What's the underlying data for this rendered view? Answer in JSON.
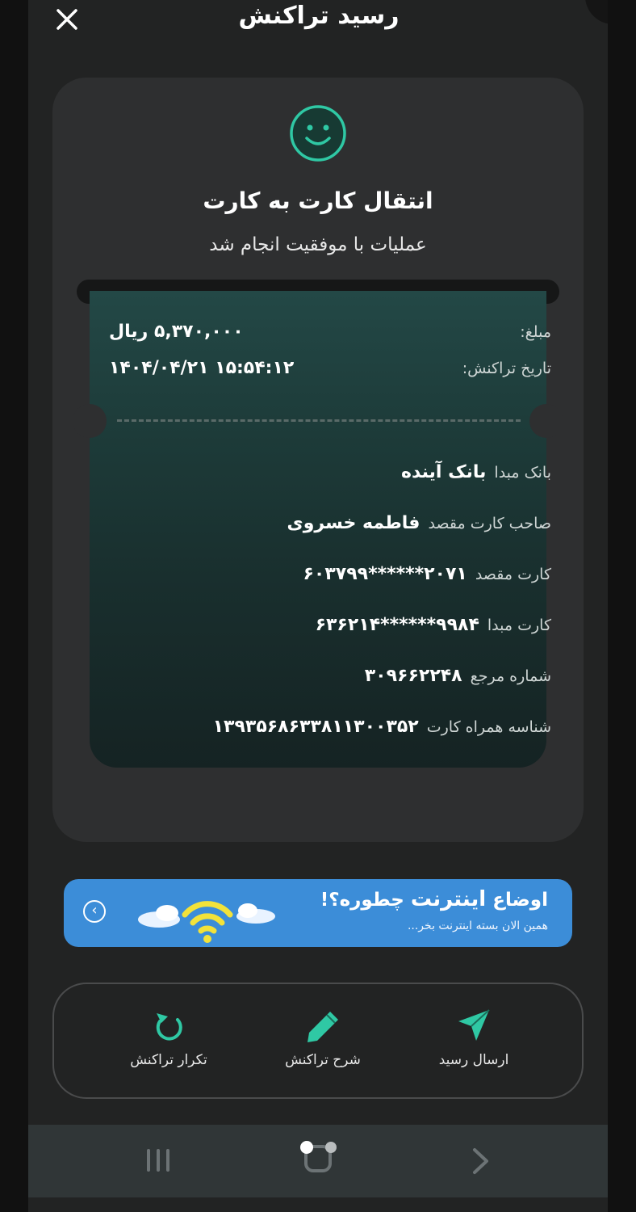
{
  "header": {
    "title": "رسید تراکنش",
    "close_icon": "close-icon"
  },
  "receipt": {
    "status_icon": "smile-icon",
    "heading": "انتقال کارت به کارت",
    "subtitle": "عملیات با موفقیت انجام شد",
    "amount": {
      "label": "مبلغ:",
      "value": "۵,۳۷۰,۰۰۰ ریال"
    },
    "date": {
      "label": "تاریخ تراکنش:",
      "value": "۱۴۰۴/۰۴/۲۱ ۱۵:۵۴:۱۲"
    },
    "details": [
      {
        "label": "بانک مبدا",
        "value": "بانک آینده"
      },
      {
        "label": "صاحب کارت مقصد",
        "value": "فاطمه خسروی"
      },
      {
        "label": "کارت مقصد",
        "value": "۶۰۳۷۹۹******۲۰۷۱"
      },
      {
        "label": "کارت مبدا",
        "value": "۶۳۶۲۱۴******۹۹۸۴"
      },
      {
        "label": "شماره مرجع",
        "value": "۳۰۹۶۶۲۲۴۸"
      },
      {
        "label": "شناسه همراه کارت",
        "value": "۱۳۹۳۵۶۸۶۳۳۸۱۱۳۰۰۳۵۲"
      }
    ]
  },
  "banner": {
    "title_prefix": "اوضاع",
    "title_bold": "اینترنت",
    "title_suffix": "چطوره؟!",
    "subtitle": "همین الان بسته اینترنت بخر...",
    "image": "wifi-cloud-illustration",
    "arrow_icon": "chevron-left-circle-icon"
  },
  "actions": [
    {
      "label": "ارسال رسید",
      "icon": "send-icon"
    },
    {
      "label": "شرح تراکنش",
      "icon": "pencil-icon"
    },
    {
      "label": "تکرار تراکنش",
      "icon": "repeat-icon"
    }
  ],
  "colors": {
    "accent": "#2fc8a4",
    "banner": "#3c8dd8",
    "card": "#2e2f30",
    "background": "#222323"
  }
}
